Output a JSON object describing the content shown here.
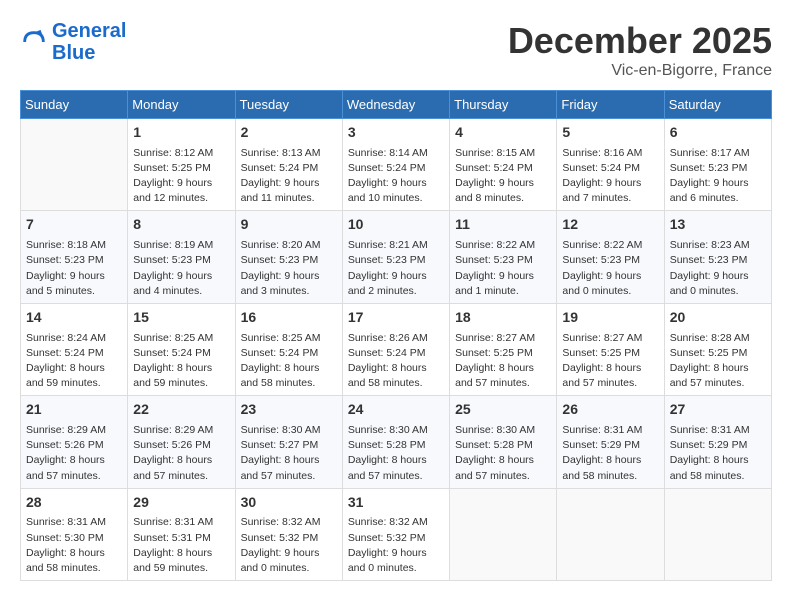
{
  "header": {
    "logo_line1": "General",
    "logo_line2": "Blue",
    "month": "December 2025",
    "location": "Vic-en-Bigorre, France"
  },
  "weekdays": [
    "Sunday",
    "Monday",
    "Tuesday",
    "Wednesday",
    "Thursday",
    "Friday",
    "Saturday"
  ],
  "weeks": [
    [
      {
        "day": "",
        "info": ""
      },
      {
        "day": "1",
        "info": "Sunrise: 8:12 AM\nSunset: 5:25 PM\nDaylight: 9 hours\nand 12 minutes."
      },
      {
        "day": "2",
        "info": "Sunrise: 8:13 AM\nSunset: 5:24 PM\nDaylight: 9 hours\nand 11 minutes."
      },
      {
        "day": "3",
        "info": "Sunrise: 8:14 AM\nSunset: 5:24 PM\nDaylight: 9 hours\nand 10 minutes."
      },
      {
        "day": "4",
        "info": "Sunrise: 8:15 AM\nSunset: 5:24 PM\nDaylight: 9 hours\nand 8 minutes."
      },
      {
        "day": "5",
        "info": "Sunrise: 8:16 AM\nSunset: 5:24 PM\nDaylight: 9 hours\nand 7 minutes."
      },
      {
        "day": "6",
        "info": "Sunrise: 8:17 AM\nSunset: 5:23 PM\nDaylight: 9 hours\nand 6 minutes."
      }
    ],
    [
      {
        "day": "7",
        "info": "Sunrise: 8:18 AM\nSunset: 5:23 PM\nDaylight: 9 hours\nand 5 minutes."
      },
      {
        "day": "8",
        "info": "Sunrise: 8:19 AM\nSunset: 5:23 PM\nDaylight: 9 hours\nand 4 minutes."
      },
      {
        "day": "9",
        "info": "Sunrise: 8:20 AM\nSunset: 5:23 PM\nDaylight: 9 hours\nand 3 minutes."
      },
      {
        "day": "10",
        "info": "Sunrise: 8:21 AM\nSunset: 5:23 PM\nDaylight: 9 hours\nand 2 minutes."
      },
      {
        "day": "11",
        "info": "Sunrise: 8:22 AM\nSunset: 5:23 PM\nDaylight: 9 hours\nand 1 minute."
      },
      {
        "day": "12",
        "info": "Sunrise: 8:22 AM\nSunset: 5:23 PM\nDaylight: 9 hours\nand 0 minutes."
      },
      {
        "day": "13",
        "info": "Sunrise: 8:23 AM\nSunset: 5:23 PM\nDaylight: 9 hours\nand 0 minutes."
      }
    ],
    [
      {
        "day": "14",
        "info": "Sunrise: 8:24 AM\nSunset: 5:24 PM\nDaylight: 8 hours\nand 59 minutes."
      },
      {
        "day": "15",
        "info": "Sunrise: 8:25 AM\nSunset: 5:24 PM\nDaylight: 8 hours\nand 59 minutes."
      },
      {
        "day": "16",
        "info": "Sunrise: 8:25 AM\nSunset: 5:24 PM\nDaylight: 8 hours\nand 58 minutes."
      },
      {
        "day": "17",
        "info": "Sunrise: 8:26 AM\nSunset: 5:24 PM\nDaylight: 8 hours\nand 58 minutes."
      },
      {
        "day": "18",
        "info": "Sunrise: 8:27 AM\nSunset: 5:25 PM\nDaylight: 8 hours\nand 57 minutes."
      },
      {
        "day": "19",
        "info": "Sunrise: 8:27 AM\nSunset: 5:25 PM\nDaylight: 8 hours\nand 57 minutes."
      },
      {
        "day": "20",
        "info": "Sunrise: 8:28 AM\nSunset: 5:25 PM\nDaylight: 8 hours\nand 57 minutes."
      }
    ],
    [
      {
        "day": "21",
        "info": "Sunrise: 8:29 AM\nSunset: 5:26 PM\nDaylight: 8 hours\nand 57 minutes."
      },
      {
        "day": "22",
        "info": "Sunrise: 8:29 AM\nSunset: 5:26 PM\nDaylight: 8 hours\nand 57 minutes."
      },
      {
        "day": "23",
        "info": "Sunrise: 8:30 AM\nSunset: 5:27 PM\nDaylight: 8 hours\nand 57 minutes."
      },
      {
        "day": "24",
        "info": "Sunrise: 8:30 AM\nSunset: 5:28 PM\nDaylight: 8 hours\nand 57 minutes."
      },
      {
        "day": "25",
        "info": "Sunrise: 8:30 AM\nSunset: 5:28 PM\nDaylight: 8 hours\nand 57 minutes."
      },
      {
        "day": "26",
        "info": "Sunrise: 8:31 AM\nSunset: 5:29 PM\nDaylight: 8 hours\nand 58 minutes."
      },
      {
        "day": "27",
        "info": "Sunrise: 8:31 AM\nSunset: 5:29 PM\nDaylight: 8 hours\nand 58 minutes."
      }
    ],
    [
      {
        "day": "28",
        "info": "Sunrise: 8:31 AM\nSunset: 5:30 PM\nDaylight: 8 hours\nand 58 minutes."
      },
      {
        "day": "29",
        "info": "Sunrise: 8:31 AM\nSunset: 5:31 PM\nDaylight: 8 hours\nand 59 minutes."
      },
      {
        "day": "30",
        "info": "Sunrise: 8:32 AM\nSunset: 5:32 PM\nDaylight: 9 hours\nand 0 minutes."
      },
      {
        "day": "31",
        "info": "Sunrise: 8:32 AM\nSunset: 5:32 PM\nDaylight: 9 hours\nand 0 minutes."
      },
      {
        "day": "",
        "info": ""
      },
      {
        "day": "",
        "info": ""
      },
      {
        "day": "",
        "info": ""
      }
    ]
  ]
}
